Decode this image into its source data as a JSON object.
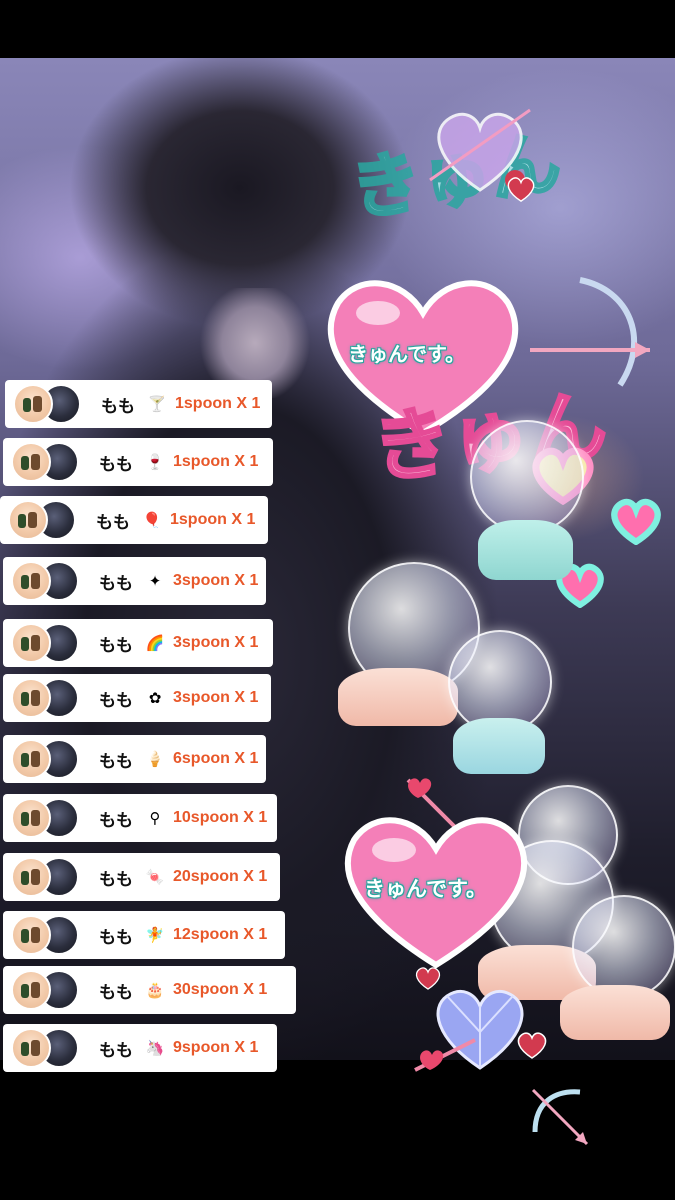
{
  "stickers": {
    "heart_text_top": "きゅんです。",
    "heart_text_bottom": "きゅんです。",
    "kyun_pink": "きゅん",
    "kyun_teal": "きゅん"
  },
  "gift_rows": [
    {
      "name": "もも",
      "gift_icon": "cocktail-icon",
      "amount": "1spoon X 1"
    },
    {
      "name": "もも",
      "gift_icon": "wine-glass-icon",
      "amount": "1spoon X 1"
    },
    {
      "name": "もも",
      "gift_icon": "balloon-icon",
      "amount": "1spoon X 1"
    },
    {
      "name": "もも",
      "gift_icon": "star-wand-icon",
      "amount": "3spoon X 1"
    },
    {
      "name": "もも",
      "gift_icon": "rainbow-ball-icon",
      "amount": "3spoon X 1"
    },
    {
      "name": "もも",
      "gift_icon": "sparkle-flower-icon",
      "amount": "3spoon X 1"
    },
    {
      "name": "もも",
      "gift_icon": "ice-cream-icon",
      "amount": "6spoon X 1"
    },
    {
      "name": "もも",
      "gift_icon": "magic-wand-icon",
      "amount": "10spoon X 1"
    },
    {
      "name": "もも",
      "gift_icon": "candy-icon",
      "amount": "20spoon X 1"
    },
    {
      "name": "もも",
      "gift_icon": "fairy-icon",
      "amount": "12spoon X 1"
    },
    {
      "name": "もも",
      "gift_icon": "cake-icon",
      "amount": "30spoon X 1"
    },
    {
      "name": "もも",
      "gift_icon": "unicorn-icon",
      "amount": "9spoon X 1"
    }
  ],
  "colors": {
    "amount": "#e8582a",
    "heart_pink": "#f47fb8",
    "teal_outline": "#2aa7a0",
    "row_bg": "#ffffff"
  }
}
